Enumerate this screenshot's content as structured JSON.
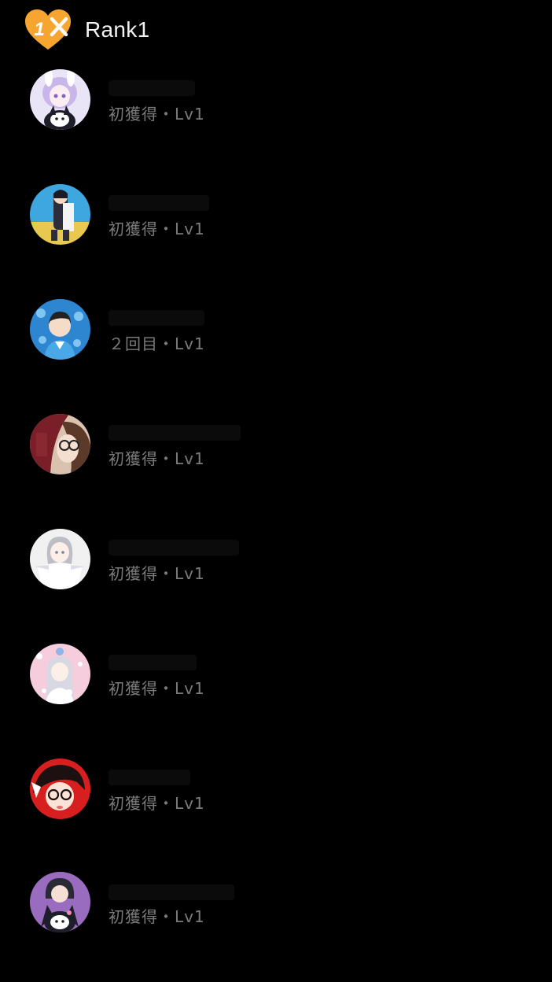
{
  "header": {
    "badge_text": "1",
    "badge_icon": "heart-x-rank-badge-icon",
    "title": "Rank1",
    "accent_color": "#f7a531"
  },
  "rows": [
    {
      "meta": "初獲得・Lv1",
      "avatar_theme": "lavender-bunny-girl-with-kuromi"
    },
    {
      "meta": "初獲得・Lv1",
      "avatar_theme": "beach-character-blue-sky"
    },
    {
      "meta": "２回目・Lv1",
      "avatar_theme": "boy-with-jellyfish-blue"
    },
    {
      "meta": "初獲得・Lv1",
      "avatar_theme": "brown-hair-glasses-red-hat"
    },
    {
      "meta": "初獲得・Lv1",
      "avatar_theme": "silver-hair-girl-white"
    },
    {
      "meta": "初獲得・Lv1",
      "avatar_theme": "pink-background-silver-girl"
    },
    {
      "meta": "初獲得・Lv1",
      "avatar_theme": "red-background-glasses-girl"
    },
    {
      "meta": "初獲得・Lv1",
      "avatar_theme": "kuromi-purple-background"
    }
  ]
}
